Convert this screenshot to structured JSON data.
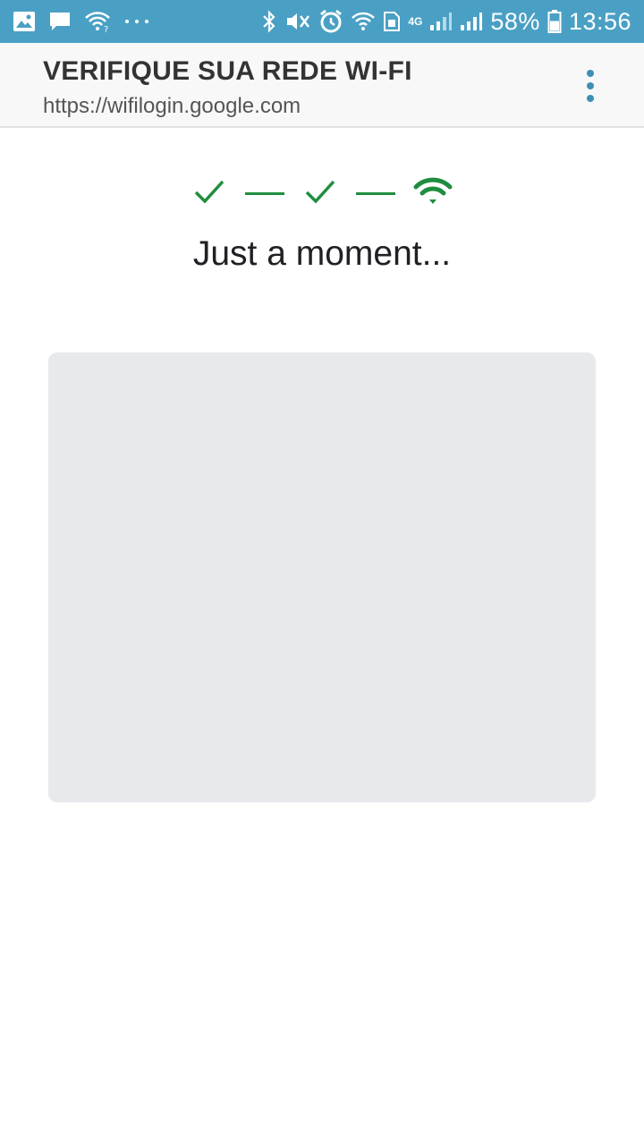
{
  "status_bar": {
    "background_color": "#4aa0c4",
    "left_icons": [
      "gallery-icon",
      "message-icon",
      "wifi-question-icon",
      "more-notifications-icon"
    ],
    "right_icons": [
      "bluetooth-icon",
      "mute-vibrate-icon",
      "alarm-icon",
      "wifi-icon",
      "sim-icon",
      "signal-4g-icon",
      "signal-icon"
    ],
    "network_label": "4G",
    "battery_percent": "58%",
    "battery_level": 0.58,
    "time": "13:56"
  },
  "app_bar": {
    "title": "VERIFIQUE SUA REDE WI-FI",
    "url": "https://wifilogin.google.com",
    "menu_icon": "more-vert-icon"
  },
  "progress": {
    "accent_color": "#1e8e3e",
    "steps": [
      {
        "icon": "check-icon",
        "state": "done"
      },
      {
        "icon": "check-icon",
        "state": "done"
      },
      {
        "icon": "wifi-icon",
        "state": "current"
      }
    ]
  },
  "main": {
    "message": "Just a moment..."
  }
}
